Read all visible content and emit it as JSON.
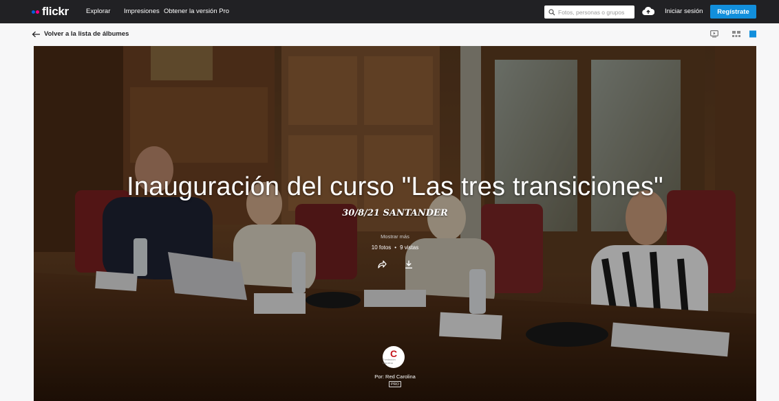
{
  "brand": {
    "name": "flickr",
    "dot_colors": [
      "#0063dc",
      "#ff0084"
    ]
  },
  "nav": {
    "links": [
      "Explorar",
      "Impresiones",
      "Obtener la versión Pro"
    ],
    "search_placeholder": "Fotos, personas o grupos",
    "login_label": "Iniciar sesión",
    "signup_label": "Regístrate",
    "signup_color": "#128fdc",
    "upload_icon": "cloud-upload-icon"
  },
  "subbar": {
    "back_label": "Volver a la lista de álbumes",
    "view_icons": [
      "slideshow-icon",
      "grid-icon",
      "full-view-icon"
    ]
  },
  "album": {
    "title": "Inauguración del curso \"Las tres transiciones\"",
    "description": "30/8/21 SANTANDER",
    "show_more": "Mostrar más",
    "photos": "10 fotos",
    "separator": "•",
    "views": "9 vistas",
    "actions": [
      "share-icon",
      "download-icon"
    ],
    "owner_label": "Por: Red Carolina",
    "owner_badge": "PRO",
    "avatar_letter": "C",
    "avatar_sub": "Fundación Carolina"
  }
}
